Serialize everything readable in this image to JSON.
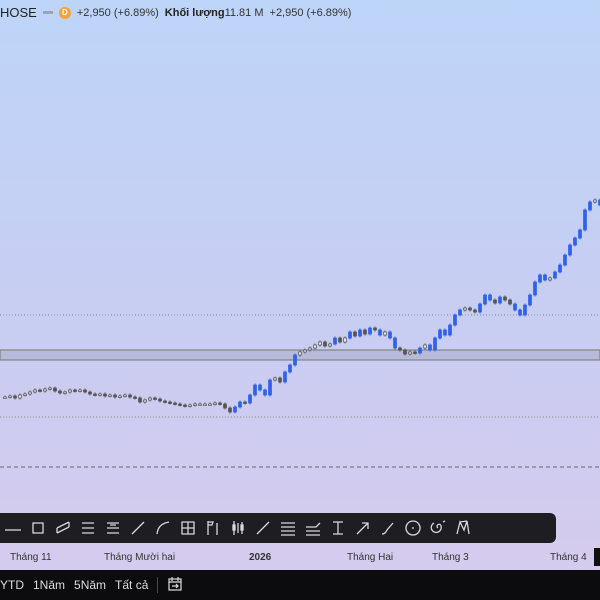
{
  "legend": {
    "symbol": "HOSE",
    "interval_badge": "D",
    "change": "+2,950 (+6.89%)",
    "volume_label": "Khối lượng",
    "volume_value": "11.81 M",
    "volume_change": "+2,950 (+6.89%)"
  },
  "x_axis": {
    "labels": [
      "Tháng 11",
      "Tháng Mười hai",
      "2026",
      "Tháng Hai",
      "Tháng 3",
      "Tháng 4"
    ]
  },
  "toolbar": {
    "icons": [
      "trend-line-icon",
      "rectangle-icon",
      "parallel-channel-icon",
      "regression-channel-icon",
      "flat-channel-icon",
      "info-line-icon",
      "curve-icon",
      "long-position-icon",
      "flag-icon",
      "candles-pattern-icon",
      "ray-icon",
      "horizontal-lines-icon",
      "fib-icon",
      "price-range-icon",
      "arrow-icon",
      "brush-icon",
      "circle-icon",
      "spiral-icon",
      "xabcd-pattern-icon"
    ]
  },
  "ranges": {
    "items": [
      "YTD",
      "1Năm",
      "5Năm",
      "Tất cả"
    ]
  },
  "colors": {
    "up_strong": "#2f62e8",
    "neutral": "#555555",
    "band": "#a8adc4"
  },
  "chart_data": {
    "type": "candlestick",
    "levels": {
      "dotted": [
        285,
        183
      ],
      "dashed": [
        133
      ],
      "band": [
        240,
        250
      ]
    },
    "closes": [
      203,
      204,
      202,
      205,
      206,
      208,
      210,
      209,
      211,
      212,
      209,
      207,
      208,
      210,
      209,
      210,
      208,
      206,
      205,
      206,
      204,
      205,
      203,
      204,
      205,
      203,
      202,
      198,
      200,
      202,
      201,
      199,
      198,
      197,
      196,
      195,
      194,
      195,
      196,
      196,
      196,
      196,
      197,
      196,
      192,
      188,
      193,
      198,
      197,
      205,
      215,
      210,
      205,
      220,
      222,
      218,
      228,
      235,
      245,
      248,
      250,
      252,
      255,
      258,
      254,
      256,
      262,
      258,
      262,
      268,
      264,
      270,
      266,
      272,
      270,
      265,
      268,
      262,
      252,
      250,
      246,
      248,
      247,
      252,
      255,
      250,
      262,
      270,
      265,
      275,
      285,
      290,
      292,
      290,
      288,
      296,
      305,
      300,
      297,
      303,
      300,
      296,
      290,
      285,
      295,
      305,
      318,
      325,
      320,
      322,
      328,
      335,
      345,
      355,
      362,
      370,
      390,
      398,
      400,
      395
    ]
  }
}
